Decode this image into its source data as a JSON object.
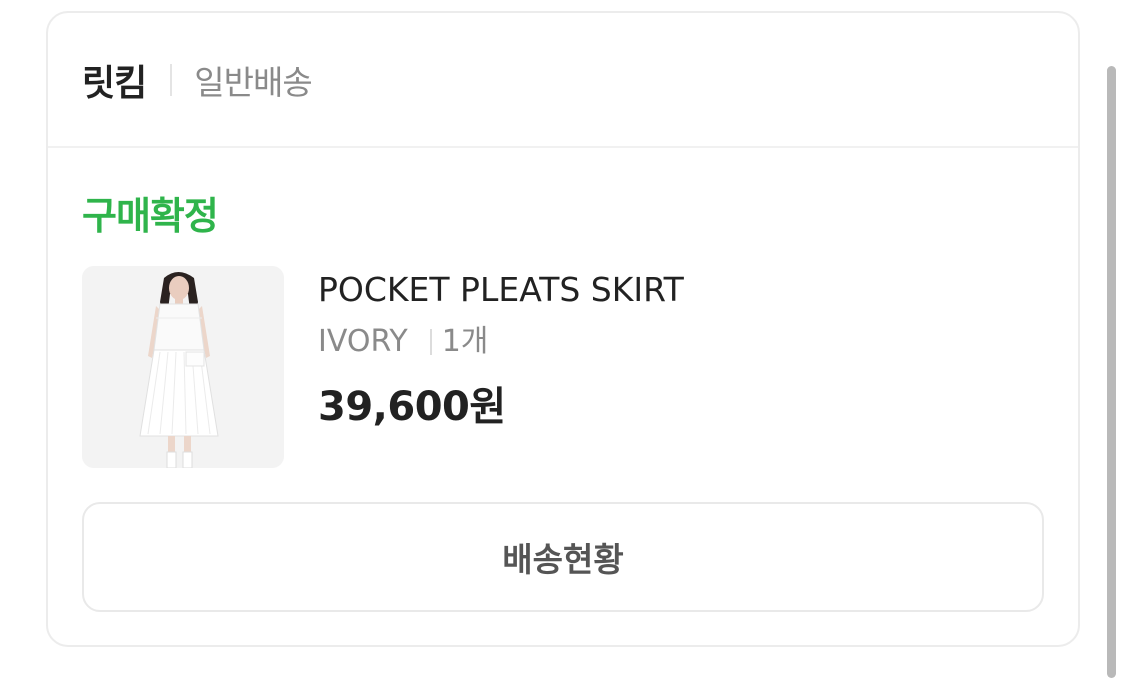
{
  "seller": {
    "name": "릿킴",
    "shipping_type": "일반배송"
  },
  "order": {
    "status": "구매확정",
    "status_color": "#2fb44b"
  },
  "product": {
    "name": "POCKET PLEATS SKIRT",
    "option": "IVORY",
    "quantity": "1개",
    "price": "39,600원",
    "thumbnail_icon": "product-photo-skirt"
  },
  "actions": {
    "track_delivery_label": "배송현황"
  }
}
